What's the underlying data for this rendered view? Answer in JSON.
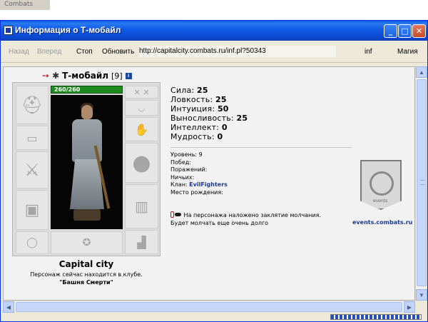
{
  "background_app": {
    "title": "Combats"
  },
  "window": {
    "title": "Информация о Т-мобайл",
    "controls": {
      "minimize": "_",
      "maximize": "□",
      "close": "✕"
    }
  },
  "navbar": {
    "back": "Назад",
    "forward": "Вперед",
    "stop": "Стоп",
    "refresh": "Обновить",
    "url": "http://capitalcity.combats.ru/inf.pl?50343",
    "inf": "inf",
    "magic": "Магия"
  },
  "character": {
    "name": "Т-мобайл",
    "level": "[9]",
    "info_icon": "i",
    "hp": "260/260",
    "hp_fraction": 1.0,
    "stats": [
      {
        "label": "Сила:",
        "value": "25"
      },
      {
        "label": "Ловкость:",
        "value": "25"
      },
      {
        "label": "Интуиция:",
        "value": "50"
      },
      {
        "label": "Выносливость:",
        "value": "25"
      },
      {
        "label": "Интеллект:",
        "value": "0"
      },
      {
        "label": "Мудрость:",
        "value": "0"
      }
    ],
    "info": {
      "level_label": "Уровень:",
      "level_value": "9",
      "wins_label": "Побед:",
      "losses_label": "Поражений:",
      "draws_label": "Ничьих:",
      "clan_label": "Клан:",
      "clan_value": "EvilFighters",
      "birthplace_label": "Место рождения:"
    },
    "silence_line1": "На персонажа наложено заклятие молчания.",
    "silence_line2": "Будет молчать еще очень долго",
    "city": "Capital city",
    "club_text": "Персонаж сейчас находится в клубе.",
    "club_name": "\"Башня Смерти\""
  },
  "emblem": {
    "word": "events",
    "url": "events.combats.ru"
  },
  "status": {
    "progress_fraction": 1.0
  },
  "icons": {
    "helmet": "helmet-icon",
    "bracers": "bracers-icon",
    "sword": "sword-icon",
    "armor": "armor-icon",
    "belt": "belt-icon",
    "rings": "rings-icon",
    "amulet": "amulet-icon",
    "gloves": "gloves-icon",
    "shield": "shield-icon",
    "leggings": "leggings-icon",
    "boots": "boots-icon"
  }
}
